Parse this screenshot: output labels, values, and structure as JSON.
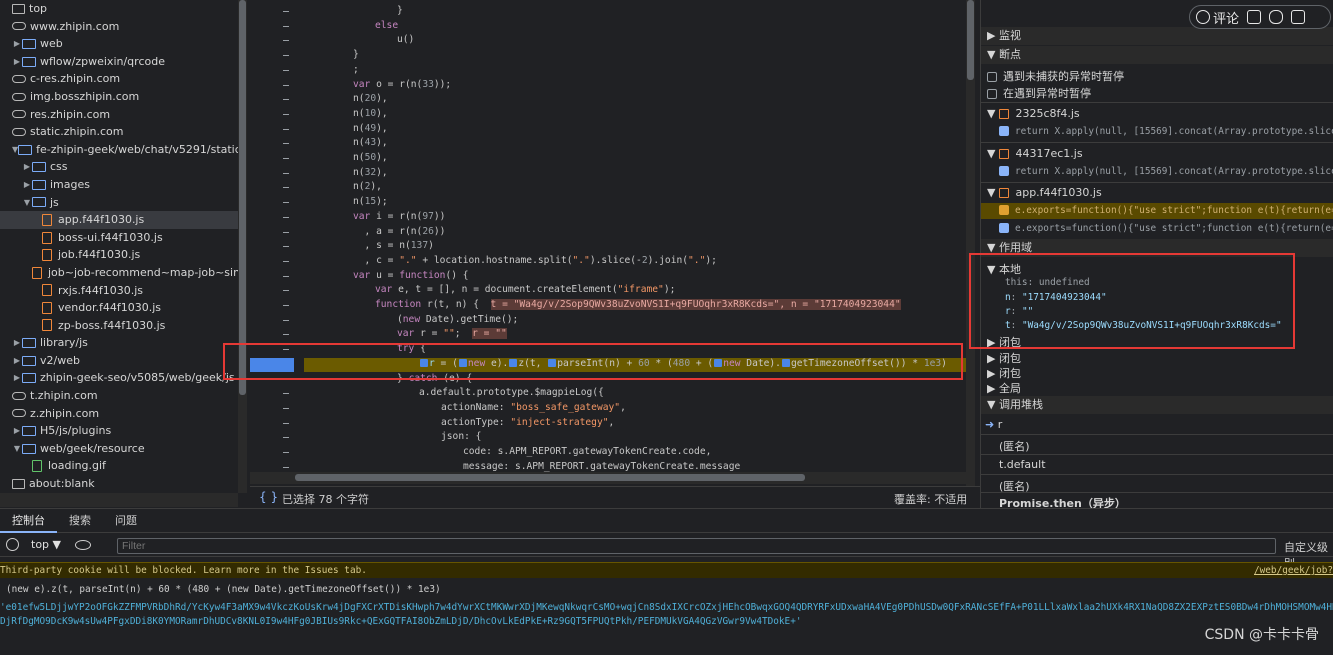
{
  "tree": {
    "rows": [
      {
        "label": "top",
        "type": "page",
        "indent": 0,
        "tri": ""
      },
      {
        "label": "www.zhipin.com",
        "type": "cloud",
        "indent": 0,
        "tri": ""
      },
      {
        "label": "web",
        "type": "folder",
        "indent": 1,
        "tri": "▶"
      },
      {
        "label": "wflow/zpweixin/qrcode",
        "type": "folder",
        "indent": 1,
        "tri": "▶"
      },
      {
        "label": "c-res.zhipin.com",
        "type": "cloud",
        "indent": 0,
        "tri": ""
      },
      {
        "label": "img.bosszhipin.com",
        "type": "cloud",
        "indent": 0,
        "tri": ""
      },
      {
        "label": "res.zhipin.com",
        "type": "cloud",
        "indent": 0,
        "tri": ""
      },
      {
        "label": "static.zhipin.com",
        "type": "cloud",
        "indent": 0,
        "tri": ""
      },
      {
        "label": "fe-zhipin-geek/web/chat/v5291/static",
        "type": "folder",
        "indent": 1,
        "tri": "▼"
      },
      {
        "label": "css",
        "type": "folder",
        "indent": 2,
        "tri": "▶"
      },
      {
        "label": "images",
        "type": "folder",
        "indent": 2,
        "tri": "▶"
      },
      {
        "label": "js",
        "type": "folder",
        "indent": 2,
        "tri": "▼"
      },
      {
        "label": "app.f44f1030.js",
        "type": "file",
        "indent": 3,
        "tri": "",
        "sel": true
      },
      {
        "label": "boss-ui.f44f1030.js",
        "type": "file",
        "indent": 3,
        "tri": ""
      },
      {
        "label": "job.f44f1030.js",
        "type": "file",
        "indent": 3,
        "tri": ""
      },
      {
        "label": "job~job-recommend~map-job~simple",
        "type": "file",
        "indent": 3,
        "tri": ""
      },
      {
        "label": "rxjs.f44f1030.js",
        "type": "file",
        "indent": 3,
        "tri": ""
      },
      {
        "label": "vendor.f44f1030.js",
        "type": "file",
        "indent": 3,
        "tri": ""
      },
      {
        "label": "zp-boss.f44f1030.js",
        "type": "file",
        "indent": 3,
        "tri": ""
      },
      {
        "label": "library/js",
        "type": "folder",
        "indent": 1,
        "tri": "▶"
      },
      {
        "label": "v2/web",
        "type": "folder",
        "indent": 1,
        "tri": "▶"
      },
      {
        "label": "zhipin-geek-seo/v5085/web/geek/js",
        "type": "folder",
        "indent": 1,
        "tri": "▶"
      },
      {
        "label": "t.zhipin.com",
        "type": "cloud",
        "indent": 0,
        "tri": ""
      },
      {
        "label": "z.zhipin.com",
        "type": "cloud",
        "indent": 0,
        "tri": ""
      },
      {
        "label": "H5/js/plugins",
        "type": "folder",
        "indent": 1,
        "tri": "▶"
      },
      {
        "label": "web/geek/resource",
        "type": "folder",
        "indent": 1,
        "tri": "▼"
      },
      {
        "label": "loading.gif",
        "type": "img",
        "indent": 2,
        "tri": ""
      },
      {
        "label": "about:blank",
        "type": "page",
        "indent": 0,
        "tri": ""
      }
    ]
  },
  "code": {
    "lines": [
      {
        "indent": 3,
        "html": "}"
      },
      {
        "indent": 2,
        "html": "<span class='k'>else</span>"
      },
      {
        "indent": 3,
        "html": "u()"
      },
      {
        "indent": 1,
        "html": "}"
      },
      {
        "indent": 1,
        "html": ";"
      },
      {
        "indent": 1,
        "html": "<span class='k'>var</span> o = r(n(<span class='n'>33</span>));"
      },
      {
        "indent": 1,
        "html": "n(<span class='n'>20</span>),"
      },
      {
        "indent": 1,
        "html": "n(<span class='n'>10</span>),"
      },
      {
        "indent": 1,
        "html": "n(<span class='n'>49</span>),"
      },
      {
        "indent": 1,
        "html": "n(<span class='n'>43</span>),"
      },
      {
        "indent": 1,
        "html": "n(<span class='n'>50</span>),"
      },
      {
        "indent": 1,
        "html": "n(<span class='n'>32</span>),"
      },
      {
        "indent": 1,
        "html": "n(<span class='n'>2</span>),"
      },
      {
        "indent": 1,
        "html": "n(<span class='n'>15</span>);"
      },
      {
        "indent": 1,
        "html": "<span class='k'>var</span> i = r(n(<span class='n'>97</span>))"
      },
      {
        "indent": 1,
        "html": "  , a = r(n(<span class='n'>26</span>))"
      },
      {
        "indent": 1,
        "html": "  , s = n(<span class='n'>137</span>)"
      },
      {
        "indent": 1,
        "html": "  , c = <span class='st'>\".\"</span> + location.hostname.split(<span class='st'>\".\"</span>).slice(-<span class='n'>2</span>).join(<span class='st'>\".\"</span>);"
      },
      {
        "indent": 1,
        "html": "<span class='k'>var</span> u = <span class='k'>function</span>() {"
      },
      {
        "indent": 2,
        "html": "<span class='k'>var</span> e, t = [], n = document.createElement(<span class='st'>\"iframe\"</span>);"
      },
      {
        "indent": 2,
        "html": "<span class='k'>function</span> r(t, n) {  <span class='inlineval'>t = \"Wa4g/v/2Sop9QWv38uZvoNVS1I+q9FUOqhr3xR8Kcds=\", n = \"1717404923044\"</span>"
      },
      {
        "indent": 3,
        "html": "(<span class='k'>new</span> Date).getTime();"
      },
      {
        "indent": 3,
        "html": "<span class='k'>var</span> r = <span class='st'>\"\"</span>;  <span class='inlineval'>r = \"\"</span>"
      },
      {
        "indent": 3,
        "html": "<span class='k'>try</span> {"
      },
      {
        "indent": 4,
        "html": "<span class='bp-ins'></span><span class='pr'>r</span> = (<span class='bp-ins'></span><span class='k'>new</span> e).<span class='bp-ins'></span>z(t, <span class='bp-ins'></span>parseInt(n) + <span class='n'>60</span> * (<span class='n'>480</span> + (<span class='bp-ins'></span><span class='k'>new</span> Date).<span class='bp-ins'></span>getTimezoneOffset()) * <span class='n'>1e3</span>)"
      },
      {
        "indent": 3,
        "html": "} <span class='k'>catch</span> (e) {"
      },
      {
        "indent": 4,
        "html": "a.default.prototype.$magpieLog({"
      },
      {
        "indent": 5,
        "html": "actionName: <span class='st'>\"boss_safe_gateway\"</span>,"
      },
      {
        "indent": 5,
        "html": "actionType: <span class='st'>\"inject-strategy\"</span>,"
      },
      {
        "indent": 5,
        "html": "json: {"
      },
      {
        "indent": 6,
        "html": "code: s.APM_REPORT.gatewayTokenCreate.code,"
      },
      {
        "indent": 6,
        "html": "message: s.APM_REPORT.gatewayTokenCreate.message"
      }
    ]
  },
  "editor_status": {
    "selection": "已选择 78 个字符",
    "coverage": "覆盖率: 不适用"
  },
  "right": {
    "watch": "监视",
    "breakpoints": "断点",
    "pause_uncaught": "遇到未捕获的异常时暂停",
    "pause_caught": "在遇到异常时暂停",
    "bp_groups": [
      {
        "file": "2325c8f4.js",
        "items": [
          "return X.apply(null, [15569].concat(Array.prototype.slice"
        ]
      },
      {
        "file": "44317ec1.js",
        "items": [
          "return X.apply(null, [15569].concat(Array.prototype.slice"
        ]
      },
      {
        "file": "app.f44f1030.js",
        "items": [
          "e.exports=function(){\"use strict\";function e(t){return(e=",
          "e.exports=function(){\"use strict\";function e(t){return(e="
        ]
      }
    ],
    "scope": "作用域",
    "local": "本地",
    "local_vars": [
      {
        "name": "this",
        "value": "undefined"
      },
      {
        "name": "n",
        "value": "\"1717404923044\""
      },
      {
        "name": "r",
        "value": "\"\""
      },
      {
        "name": "t",
        "value": "\"Wa4g/v/2Sop9QWv38uZvoNVS1I+q9FUOqhr3xR8Kcds=\""
      }
    ],
    "closures": [
      "闭包",
      "闭包",
      "闭包"
    ],
    "global": "全局",
    "call_stack": "调用堆栈",
    "frames": [
      "r",
      "(匿名)",
      "t.default",
      "(匿名)",
      "Promise.then（异步）"
    ]
  },
  "toolbar_badge": {
    "comment": "评论"
  },
  "console": {
    "tabs": [
      "控制台",
      "搜索",
      "问题"
    ],
    "context": "top",
    "filter_placeholder": "Filter",
    "custom_level": "自定义级别",
    "warning": "Third-party cookie will be blocked. Learn more in the Issues tab.",
    "warning_link": "/web/geek/job?",
    "input": "(new e).z(t, parseInt(n) + 60 * (480 + (new Date).getTimezoneOffset()) * 1e3)",
    "output1": "'e01efw5LDjjwYP2oOFGkZZFMPVRbDhRd/YcKyw4F3aMX9w4VkczKoUsKrw4jDgFXCrXTDisKHwph7w4dYwrXCtMKWwrXDjMKewqNkwqrCsMO+wqjCn8SdxIXCrcOZxjHEhcOBwqxGOQ4QDRYRFxUDxwaHA4VEg0PDhUSDw0QFxRANcSEfFA+P01LLlxaWxlaa2hUXk4RX1NaQD8ZX2EXPztES0BDw4rDhMOHSMOMw4HDn",
    "output2": "DjRfDgMO9DcK9w4sUw4PFgxDDi8K0YMORamrDhUDCv8KNL0I9w4HFg0JBIUs9Rkc+QExGQTFAI8ObZmLDjD/DhcOvLkEdPkE+Rz9GQT5FPUQtPkh/PEFDMUkVGA4QGzVGwr9Vw4TDokE+'"
  },
  "watermark": "CSDN @卡卡卡骨"
}
